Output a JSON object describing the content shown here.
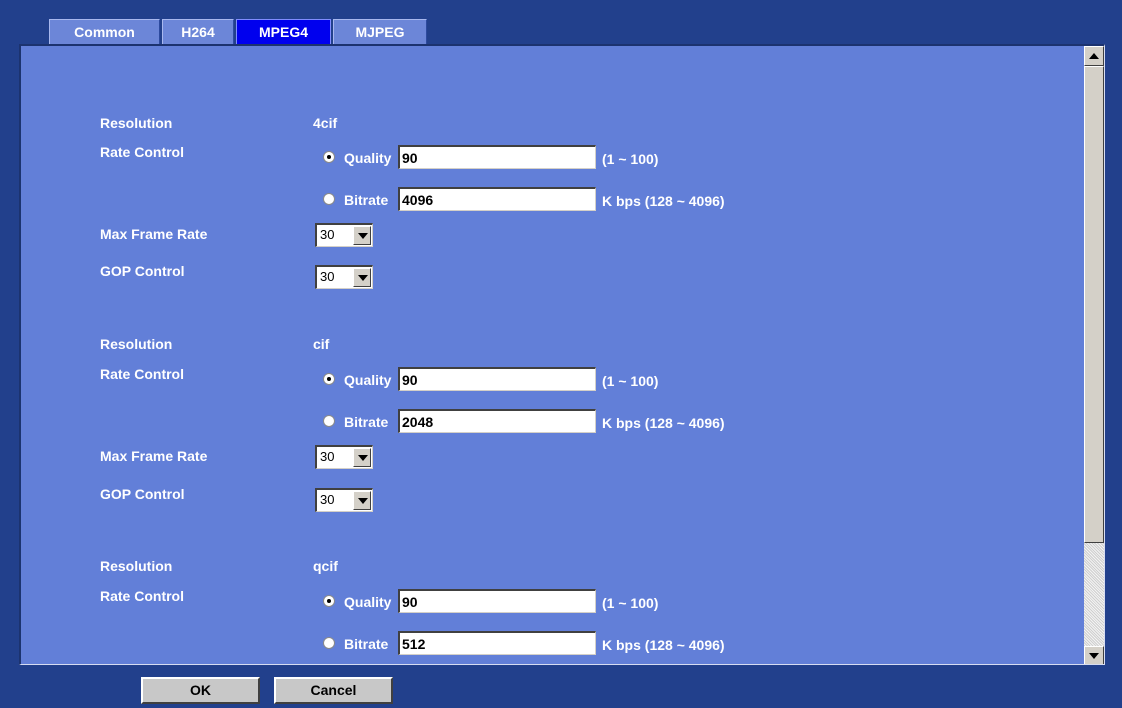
{
  "tabs": [
    {
      "label": "Common"
    },
    {
      "label": "H264"
    },
    {
      "label": "MPEG4"
    },
    {
      "label": "MJPEG"
    }
  ],
  "active_tab": "MPEG4",
  "labels": {
    "resolution": "Resolution",
    "rate_control": "Rate Control",
    "max_frame_rate": "Max Frame Rate",
    "gop_control": "GOP Control",
    "quality": "Quality",
    "bitrate": "Bitrate",
    "quality_range": "(1 ~ 100)",
    "bitrate_range": "K bps (128 ~ 4096)"
  },
  "streams": [
    {
      "resolution": "4cif",
      "rate_mode": "Quality",
      "quality": "90",
      "bitrate": "4096",
      "max_frame_rate": "30",
      "gop": "30"
    },
    {
      "resolution": "cif",
      "rate_mode": "Quality",
      "quality": "90",
      "bitrate": "2048",
      "max_frame_rate": "30",
      "gop": "30"
    },
    {
      "resolution": "qcif",
      "rate_mode": "Quality",
      "quality": "90",
      "bitrate": "512"
    }
  ],
  "buttons": {
    "ok": "OK",
    "cancel": "Cancel"
  },
  "colors": {
    "page_bg": "#22408c",
    "panel_bg": "#627fd8",
    "tab_bg": "#6c86d8",
    "active_tab_bg": "#0000ee"
  }
}
